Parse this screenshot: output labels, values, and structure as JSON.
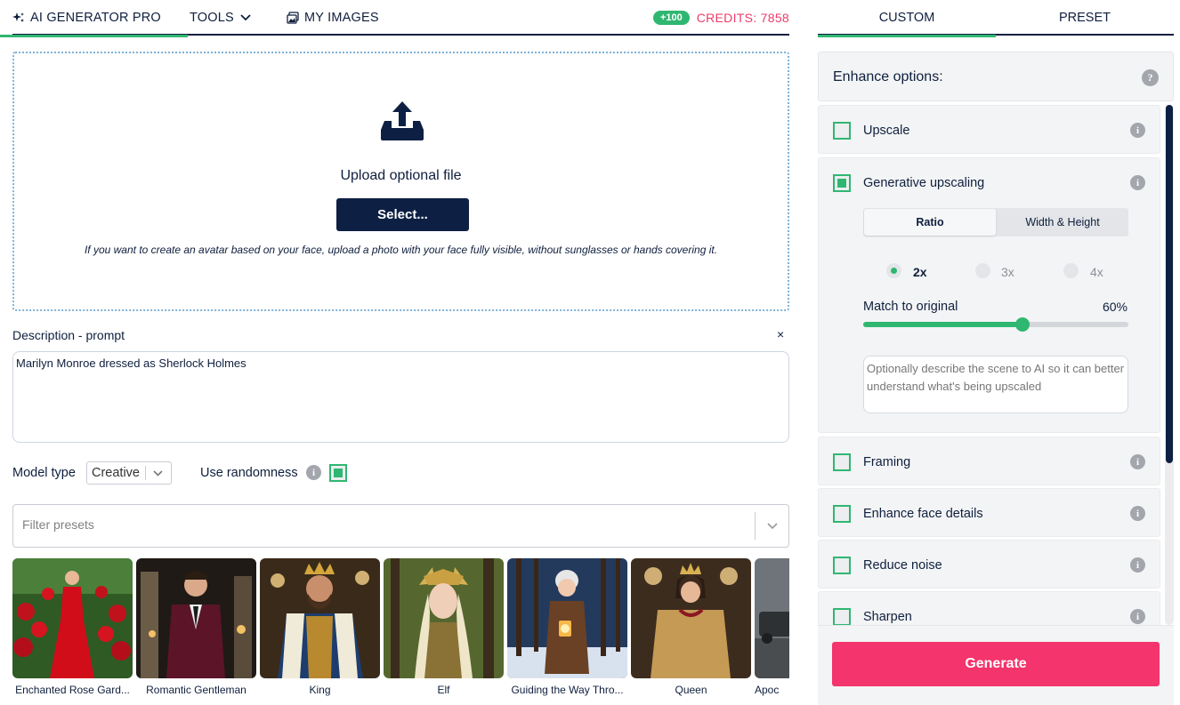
{
  "nav": {
    "tabs": [
      {
        "label": "AI GENERATOR PRO",
        "icon": "sparkle-icon"
      },
      {
        "label": "TOOLS",
        "icon": "chevron-down-icon"
      },
      {
        "label": "MY IMAGES",
        "icon": "images-icon"
      }
    ],
    "bonus_badge": "+100",
    "credits": "CREDITS: 7858"
  },
  "upload": {
    "icon": "upload-tray-icon",
    "title": "Upload optional file",
    "button": "Select...",
    "hint": "If you want to create an avatar based on your face, upload a photo with your face fully visible, without sunglasses or hands covering it."
  },
  "prompt": {
    "label": "Description - prompt",
    "close": "×",
    "value": "Marilyn Monroe dressed as Sherlock Holmes"
  },
  "model": {
    "label": "Model type",
    "value": "Creative",
    "randomness_label": "Use randomness",
    "randomness_checked": true
  },
  "filter": {
    "placeholder": "Filter presets"
  },
  "presets": [
    {
      "name": "Enchanted Rose Garden",
      "caption": "Enchanted Rose Gard..."
    },
    {
      "name": "Romantic Gentleman",
      "caption": "Romantic Gentleman"
    },
    {
      "name": "King",
      "caption": "King"
    },
    {
      "name": "Elf",
      "caption": "Elf"
    },
    {
      "name": "Guiding the Way Through",
      "caption": "Guiding the Way Thro..."
    },
    {
      "name": "Queen",
      "caption": "Queen"
    },
    {
      "name": "Apocalypse",
      "caption": "Apoc"
    }
  ],
  "right_tabs": [
    "CUSTOM",
    "PRESET"
  ],
  "enhance": {
    "title": "Enhance options:",
    "help": "?",
    "options": [
      {
        "label": "Upscale",
        "checked": false
      },
      {
        "label": "Generative upscaling",
        "checked": true
      },
      {
        "label": "Framing",
        "checked": false
      },
      {
        "label": "Enhance face details",
        "checked": false
      },
      {
        "label": "Reduce noise",
        "checked": false
      },
      {
        "label": "Sharpen",
        "checked": false
      }
    ],
    "generative": {
      "segments": [
        "Ratio",
        "Width & Height"
      ],
      "ratios": [
        {
          "label": "2x",
          "selected": true
        },
        {
          "label": "3x",
          "selected": false
        },
        {
          "label": "4x",
          "selected": false
        }
      ],
      "match_label": "Match to original",
      "match_value": "60%",
      "match_fraction": 0.6,
      "scene_placeholder": "Optionally describe the scene to AI so it can better understand what's being upscaled"
    }
  },
  "generate": "Generate",
  "colors": {
    "navy": "#0d2044",
    "green": "#2fb771",
    "pink": "#f4346c",
    "credits": "#ee3b6a"
  }
}
